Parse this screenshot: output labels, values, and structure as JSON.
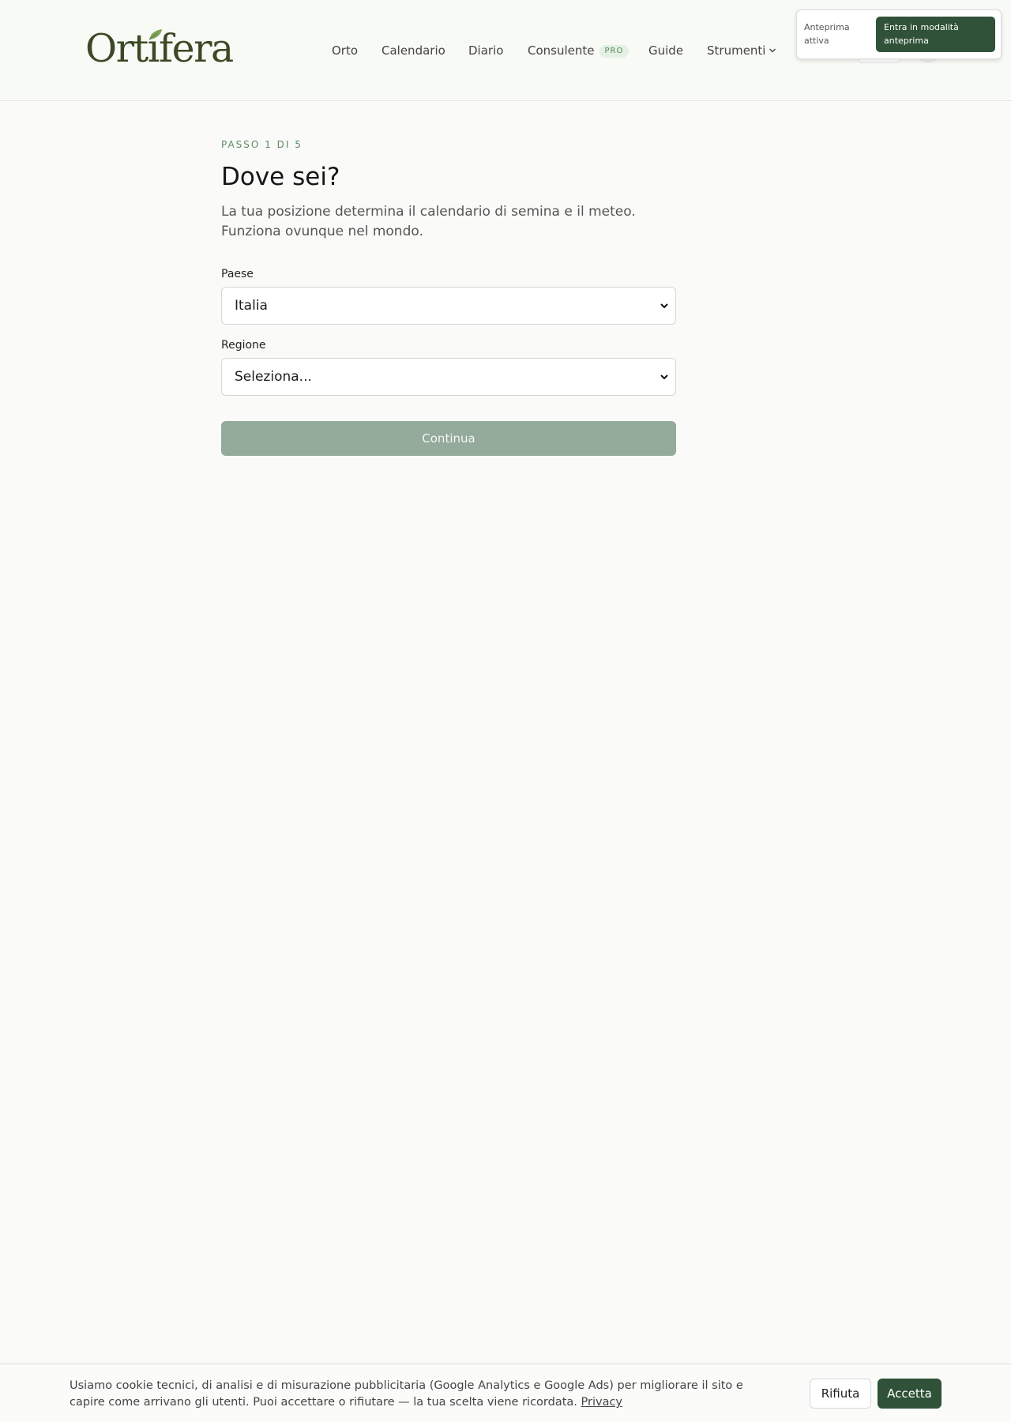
{
  "brand": {
    "name": "Ortifera"
  },
  "nav": {
    "items": [
      {
        "label": "Orto"
      },
      {
        "label": "Calendario"
      },
      {
        "label": "Diario"
      },
      {
        "label": "Consulente",
        "badge": "PRO"
      },
      {
        "label": "Guide"
      },
      {
        "label": "Strumenti"
      }
    ]
  },
  "preview": {
    "status": "Anteprima attiva",
    "button": "Entra in modalità anteprima"
  },
  "onboarding": {
    "step": "PASSO 1 DI 5",
    "title": "Dove sei?",
    "subtitle": "La tua posizione determina il calendario di semina e il meteo. Funziona ovunque nel mondo.",
    "country_label": "Paese",
    "country_value": "Italia",
    "region_label": "Regione",
    "region_value": "Seleziona...",
    "continue": "Continua"
  },
  "cookie": {
    "text": "Usiamo cookie tecnici, di analisi e di misurazione pubblicitaria (Google Analytics e Google Ads) per migliorare il sito e capire come arrivano gli utenti. Puoi accettare o rifiutare — la tua scelta viene ricordata.",
    "link": "Privacy",
    "reject": "Rifiuta",
    "accept": "Accetta"
  },
  "colors": {
    "brand_green": "#2f5238",
    "logo_olive": "#3b4a25",
    "accent_green": "#5a8a64",
    "disabled_button": "#94aa9a"
  },
  "icons": [
    "leaf-icon",
    "chevron-down-icon"
  ]
}
